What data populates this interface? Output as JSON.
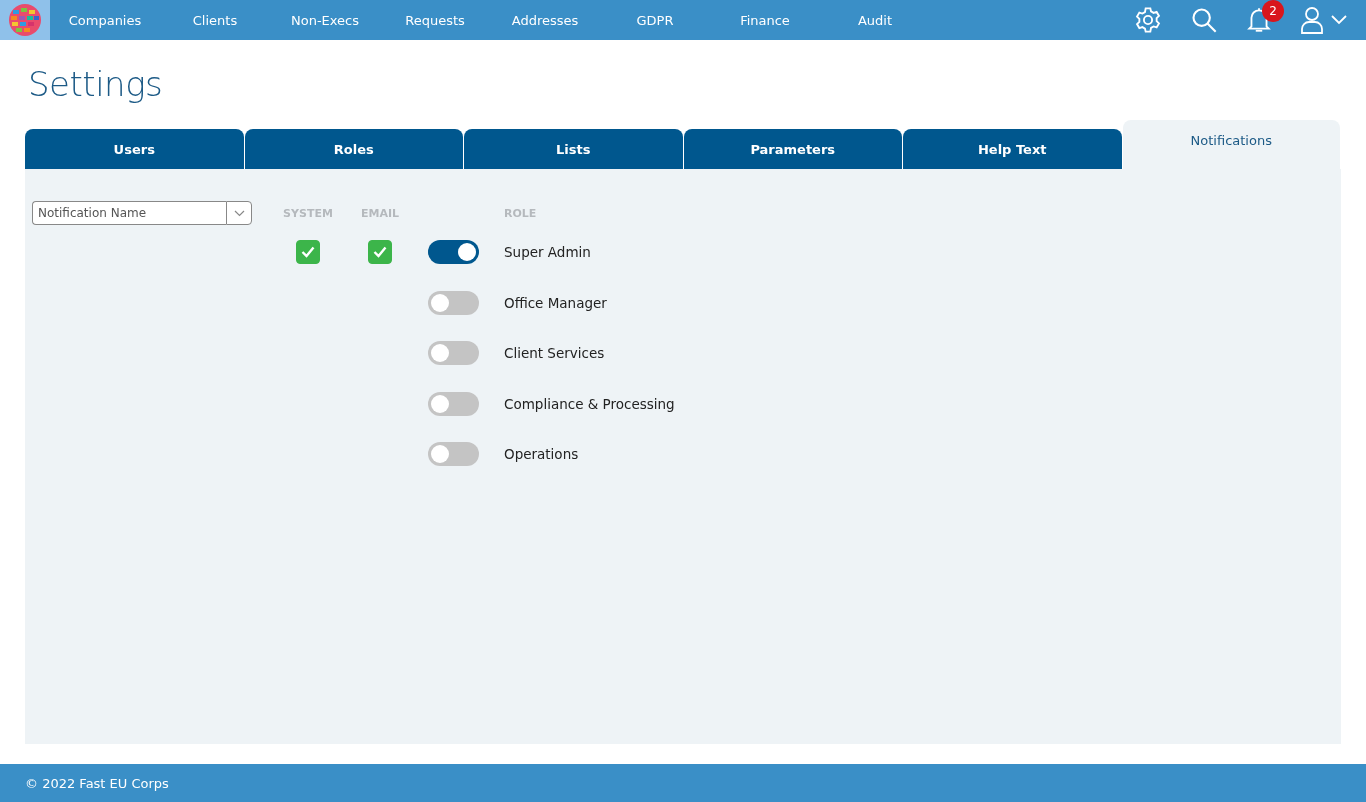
{
  "nav": {
    "items": [
      "Companies",
      "Clients",
      "Non-Execs",
      "Requests",
      "Addresses",
      "GDPR",
      "Finance",
      "Audit"
    ],
    "notification_count": "2"
  },
  "page_title": "Settings",
  "tabs": [
    {
      "label": "Users",
      "selected": false
    },
    {
      "label": "Roles",
      "selected": false
    },
    {
      "label": "Lists",
      "selected": false
    },
    {
      "label": "Parameters",
      "selected": false
    },
    {
      "label": "Help Text",
      "selected": false
    },
    {
      "label": "Notifications",
      "selected": true
    }
  ],
  "notification_select": {
    "placeholder": "Notification Name"
  },
  "columns": {
    "system": "SYSTEM",
    "email": "EMAIL",
    "role": "ROLE"
  },
  "channels": {
    "system_checked": true,
    "email_checked": true
  },
  "roles": [
    {
      "name": "Super Admin",
      "on": true
    },
    {
      "name": "Office Manager",
      "on": false
    },
    {
      "name": "Client Services",
      "on": false
    },
    {
      "name": "Compliance & Processing",
      "on": false
    },
    {
      "name": "Operations",
      "on": false
    }
  ],
  "footer": "© 2022 Fast EU Corps"
}
